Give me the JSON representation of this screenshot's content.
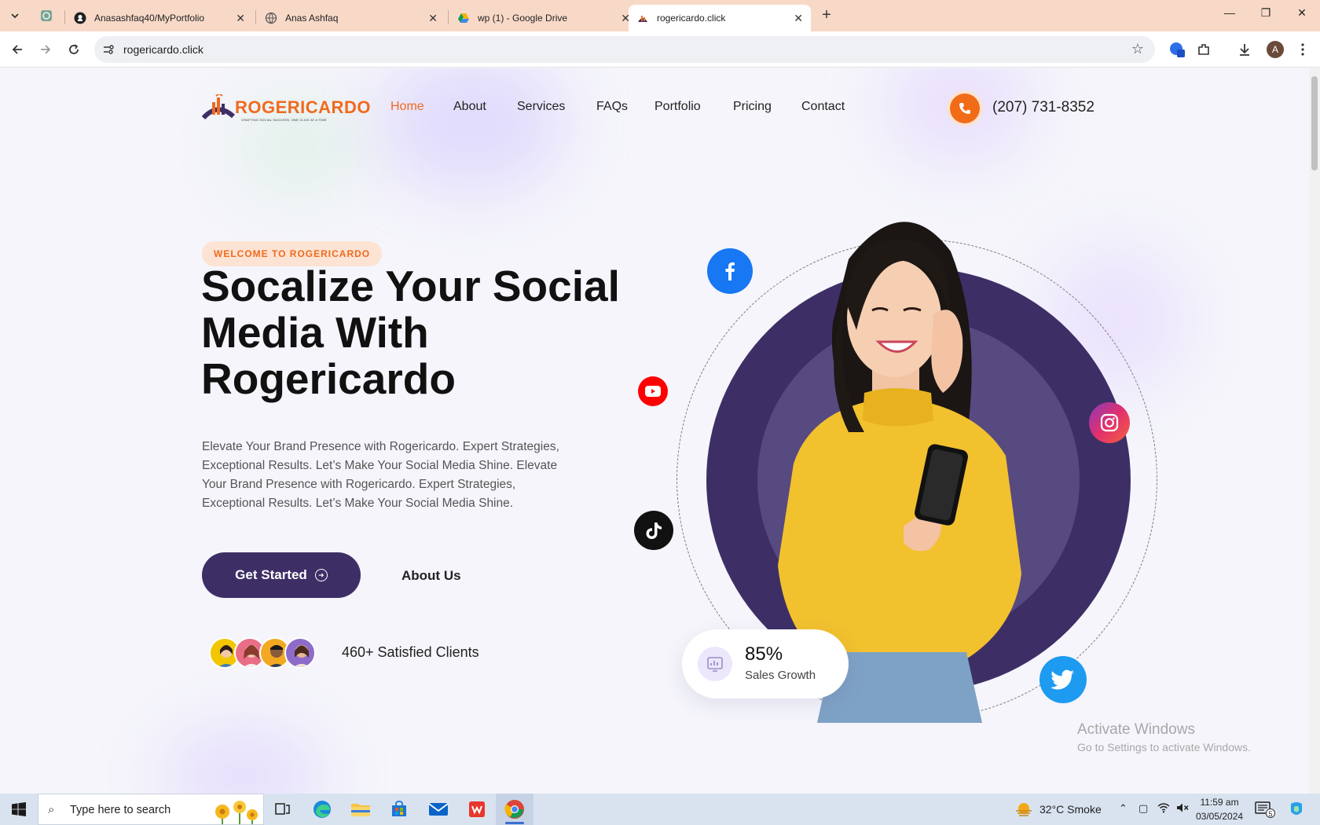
{
  "browser": {
    "tabs": [
      {
        "label": "",
        "favicon": "chatgpt-icon"
      },
      {
        "label": "Anasashfaq40/MyPortfolio",
        "favicon": "github-icon"
      },
      {
        "label": "Anas Ashfaq",
        "favicon": "globe-icon"
      },
      {
        "label": "wp (1) - Google Drive",
        "favicon": "google-drive-icon"
      },
      {
        "label": "rogericardo.click",
        "favicon": "rogericardo-icon"
      }
    ],
    "url": "rogericardo.click",
    "accent": "#f8d9c8"
  },
  "site": {
    "logo_text": "ROGERICARDO",
    "logo_tagline": "CRAFTING SOCIAL SUCCESS, ONE CLICK AT A TIME",
    "nav": [
      "Home",
      "About",
      "Services",
      "FAQs",
      "Portfolio",
      "Pricing",
      "Contact"
    ],
    "phone": "(207) 731-8352",
    "badge": "WELCOME TO ROGERICARDO",
    "headline": "Socalize Your Social Media With Rogericardo",
    "lead": "Elevate Your Brand Presence with Rogericardo. Expert Strategies, Exceptional Results. Let’s Make Your Social Media Shine. Elevate Your Brand Presence with Rogericardo. Expert Strategies, Exceptional Results. Let’s Make Your Social Media Shine.",
    "cta_primary": "Get Started",
    "cta_secondary": "About Us",
    "clients_text": "460+ Satisfied Clients",
    "stat_value": "85%",
    "stat_label": "Sales Growth",
    "brand_orange": "#f06a1e",
    "brand_purple": "#3d2f66"
  },
  "watermark": {
    "title": "Activate Windows",
    "subtitle": "Go to Settings to activate Windows."
  },
  "taskbar": {
    "search_placeholder": "Type here to search",
    "weather": "32°C  Smoke",
    "time": "11:59 am",
    "date": "03/05/2024",
    "notification_count": "5"
  }
}
